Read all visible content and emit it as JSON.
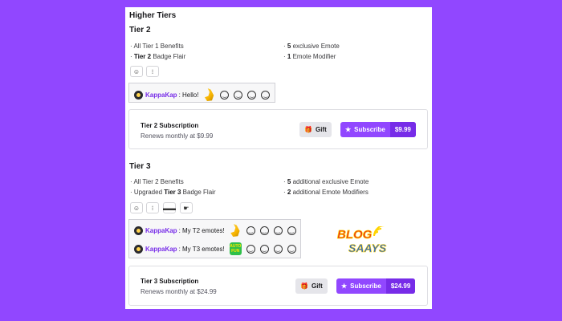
{
  "section_title": "Higher Tiers",
  "tier2": {
    "title": "Tier 2",
    "benefits_left": [
      {
        "prefix": "· All Tier 1 Benefits",
        "bold": "",
        "suffix": ""
      },
      {
        "prefix": "· ",
        "bold": "Tier 2",
        "suffix": " Badge Flair"
      }
    ],
    "benefits_right": [
      {
        "prefix": "· ",
        "bold": "5",
        "suffix": " exclusive Emote"
      },
      {
        "prefix": "· ",
        "bold": "1",
        "suffix": " Emote Modifier"
      }
    ],
    "preview": {
      "user": "KappaKap",
      "message": ": Hello!"
    },
    "card": {
      "title": "Tier 2 Subscription",
      "renew": "Renews monthly at $9.99",
      "gift": "Gift",
      "subscribe": "Subscribe",
      "price": "$9.99"
    }
  },
  "tier3": {
    "title": "Tier 3",
    "benefits_left": [
      {
        "prefix": "· All Tier 2 Benefits",
        "bold": "",
        "suffix": ""
      },
      {
        "prefix": "· Upgraded ",
        "bold": "Tier 3",
        "suffix": " Badge Flair"
      }
    ],
    "benefits_right": [
      {
        "prefix": "· ",
        "bold": "5",
        "suffix": " additional exclusive Emote"
      },
      {
        "prefix": "· ",
        "bold": "2",
        "suffix": " additional Emote Modifiers"
      }
    ],
    "preview_rows": [
      {
        "user": "KappaKap",
        "message": ": My T2 emotes!"
      },
      {
        "user": "KappaKap",
        "message": ": My T3 emotes!"
      }
    ],
    "card": {
      "title": "Tier 3 Subscription",
      "renew": "Renews monthly at $24.99",
      "gift": "Gift",
      "subscribe": "Subscribe",
      "price": "$24.99"
    }
  },
  "watermark": "BLOG SAAYS",
  "colors": {
    "background": "#9147ff",
    "accent": "#772ce8"
  }
}
